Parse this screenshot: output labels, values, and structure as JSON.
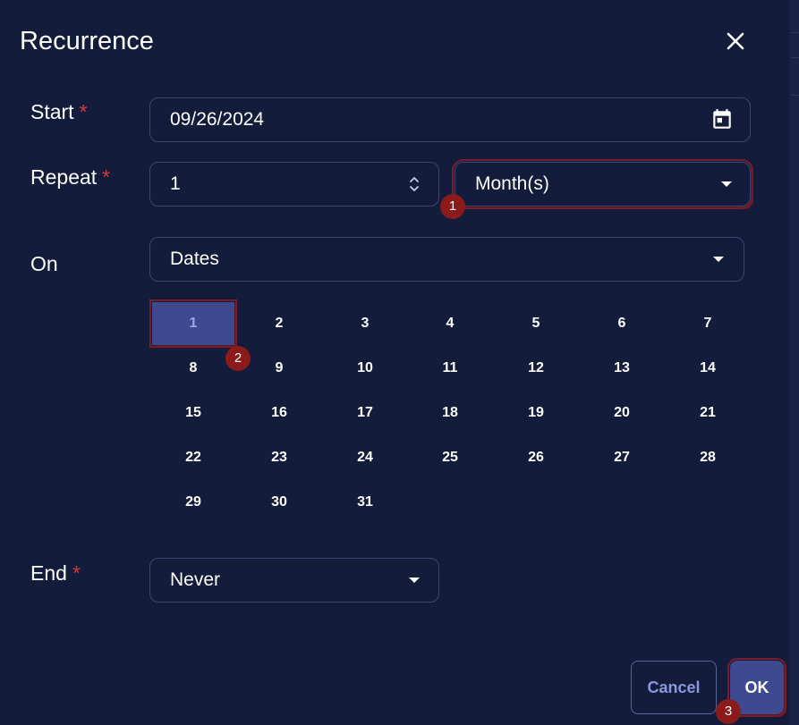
{
  "dialog": {
    "title": "Recurrence",
    "close_icon": "close-icon"
  },
  "start": {
    "label": "Start",
    "required_mark": "*",
    "value": "09/26/2024",
    "icon": "calendar-icon"
  },
  "repeat": {
    "label": "Repeat",
    "required_mark": "*",
    "interval": "1",
    "interval_icon": "spinner-arrows-icon",
    "unit": "Month(s)"
  },
  "on": {
    "label": "On",
    "mode": "Dates",
    "days": [
      "1",
      "2",
      "3",
      "4",
      "5",
      "6",
      "7",
      "8",
      "9",
      "10",
      "11",
      "12",
      "13",
      "14",
      "15",
      "16",
      "17",
      "18",
      "19",
      "20",
      "21",
      "22",
      "23",
      "24",
      "25",
      "26",
      "27",
      "28",
      "29",
      "30",
      "31"
    ],
    "selected_day": "1"
  },
  "end": {
    "label": "End",
    "required_mark": "*",
    "value": "Never"
  },
  "actions": {
    "cancel_label": "Cancel",
    "ok_label": "OK"
  },
  "annotations": {
    "badge_1": "1",
    "badge_2": "2",
    "badge_3": "3"
  },
  "colors": {
    "background": "#141c3c",
    "accent": "#3d4a8f",
    "required": "#d23b3b",
    "badge": "#8b1a1a"
  }
}
